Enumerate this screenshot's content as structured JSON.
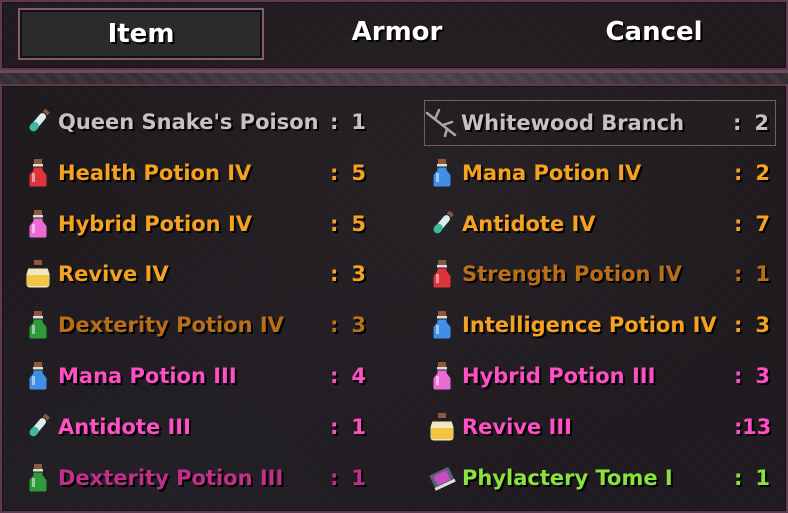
{
  "tabs": [
    {
      "label": "Item",
      "selected": true
    },
    {
      "label": "Armor",
      "selected": false
    },
    {
      "label": "Cancel",
      "selected": false
    }
  ],
  "items": [
    {
      "name": "Queen Snake's Poison",
      "qty": "1",
      "color": "#c7c2c2",
      "icon": "vial-icon"
    },
    {
      "name": "Whitewood Branch",
      "qty": "2",
      "color": "#c7c2c2",
      "icon": "branch-icon",
      "selected": true
    },
    {
      "name": "Health Potion IV",
      "qty": "5",
      "color": "#f5a223",
      "icon": "red-potion-icon"
    },
    {
      "name": "Mana Potion IV",
      "qty": "2",
      "color": "#f5a223",
      "icon": "blue-potion-icon"
    },
    {
      "name": "Hybrid Potion IV",
      "qty": "5",
      "color": "#f5a223",
      "icon": "pink-potion-icon"
    },
    {
      "name": "Antidote IV",
      "qty": "7",
      "color": "#f5a223",
      "icon": "vial-icon"
    },
    {
      "name": "Revive IV",
      "qty": "3",
      "color": "#f5a223",
      "icon": "revive-icon"
    },
    {
      "name": "Strength Potion IV",
      "qty": "1",
      "color": "#b86e1a",
      "icon": "red-potion-icon"
    },
    {
      "name": "Dexterity Potion IV",
      "qty": "3",
      "color": "#b86e1a",
      "icon": "green-potion-icon"
    },
    {
      "name": "Intelligence Potion IV",
      "qty": "3",
      "color": "#f5a223",
      "icon": "blue-potion-icon"
    },
    {
      "name": "Mana Potion III",
      "qty": "4",
      "color": "#ff4fc4",
      "icon": "blue-potion-icon"
    },
    {
      "name": "Hybrid Potion III",
      "qty": "3",
      "color": "#ff4fc4",
      "icon": "pink-potion-icon"
    },
    {
      "name": "Antidote III",
      "qty": "1",
      "color": "#ff4fc4",
      "icon": "vial-icon"
    },
    {
      "name": "Revive III",
      "qty": "13",
      "color": "#ff4fc4",
      "icon": "revive-icon"
    },
    {
      "name": "Dexterity Potion III",
      "qty": "1",
      "color": "#c22f8a",
      "icon": "green-potion-icon"
    },
    {
      "name": "Phylactery Tome I",
      "qty": "1",
      "color": "#8be23f",
      "icon": "tome-icon"
    }
  ],
  "separator": ":"
}
